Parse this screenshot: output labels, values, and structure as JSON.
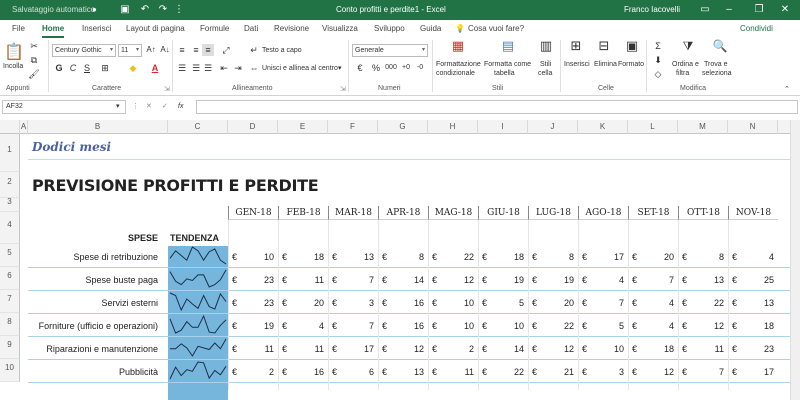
{
  "titlebar": {
    "autosave_label": "Salvataggio automatico",
    "autosave_state": "●",
    "doc_title": "Conto profitti e perdite1  -  Excel",
    "user": "Franco Iacovelli"
  },
  "tabs": [
    "File",
    "Home",
    "Inserisci",
    "Layout di pagina",
    "Formule",
    "Dati",
    "Revisione",
    "Visualizza",
    "Sviluppo",
    "Guida"
  ],
  "active_tab": "Home",
  "tell_me": "Cosa vuoi fare?",
  "share": "Condividi",
  "ribbon": {
    "paste": "Incolla",
    "font_name": "Century Gothic",
    "font_size": "11",
    "bold": "G",
    "italic": "C",
    "underline": "S",
    "wrap_text": "Testo a capo",
    "merge_center": "Unisci e allinea al centro",
    "number_format": "Generale",
    "currency": "€",
    "percent": "%",
    "thousands": "000",
    "cond_format": [
      "Formattazione",
      "condizionale"
    ],
    "format_table": [
      "Formatta come",
      "tabella"
    ],
    "cell_styles": [
      "Stili",
      "cella"
    ],
    "insert": "Inserisci",
    "delete": "Elimina",
    "format": "Formato",
    "sort_filter": [
      "Ordina e",
      "filtra"
    ],
    "find_select": [
      "Trova e",
      "seleziona"
    ],
    "groups": [
      "Appunti",
      "Carattere",
      "Allineamento",
      "Numeri",
      "Stili",
      "Celle",
      "Modifica"
    ]
  },
  "formula": {
    "namebox": "AF32",
    "fx": "fx",
    "value": ""
  },
  "columns": [
    "A",
    "B",
    "C",
    "D",
    "E",
    "F",
    "G",
    "H",
    "I",
    "J",
    "K",
    "L",
    "M",
    "N"
  ],
  "rows": [
    "1",
    "2",
    "3",
    "4",
    "5",
    "6",
    "7",
    "8",
    "9",
    "10"
  ],
  "sheet": {
    "subtitle": "Dodici mesi",
    "title": "PREVISIONE PROFITTI E PERDITE",
    "months": [
      "GEN-18",
      "FEB-18",
      "MAR-18",
      "APR-18",
      "MAG-18",
      "GIU-18",
      "LUG-18",
      "AGO-18",
      "SET-18",
      "OTT-18",
      "NOV-18"
    ],
    "spese_header": "SPESE",
    "trend_header": "TENDENZA",
    "currency_symbol": "€",
    "expenses": [
      {
        "name": "Spese di retribuzione",
        "values": [
          10,
          18,
          13,
          8,
          22,
          18,
          8,
          17,
          20,
          8,
          4
        ]
      },
      {
        "name": "Spese buste paga",
        "values": [
          23,
          11,
          7,
          14,
          12,
          19,
          19,
          4,
          7,
          13,
          25
        ]
      },
      {
        "name": "Servizi esterni",
        "values": [
          23,
          20,
          3,
          16,
          10,
          5,
          20,
          7,
          4,
          22,
          13
        ]
      },
      {
        "name": "Forniture (ufficio e operazioni)",
        "values": [
          19,
          4,
          7,
          16,
          10,
          10,
          22,
          5,
          4,
          12,
          18
        ]
      },
      {
        "name": "Riparazioni e manutenzione",
        "values": [
          11,
          11,
          17,
          12,
          2,
          14,
          12,
          10,
          18,
          11,
          23
        ]
      },
      {
        "name": "Pubblicità",
        "values": [
          2,
          16,
          6,
          13,
          11,
          22,
          21,
          3,
          12,
          7,
          17
        ]
      }
    ]
  },
  "colors": {
    "excel_green": "#217346",
    "trend_fill": "#76b5dc",
    "title_blue": "#4a5fa8",
    "row_line": "#a9d2e8"
  }
}
